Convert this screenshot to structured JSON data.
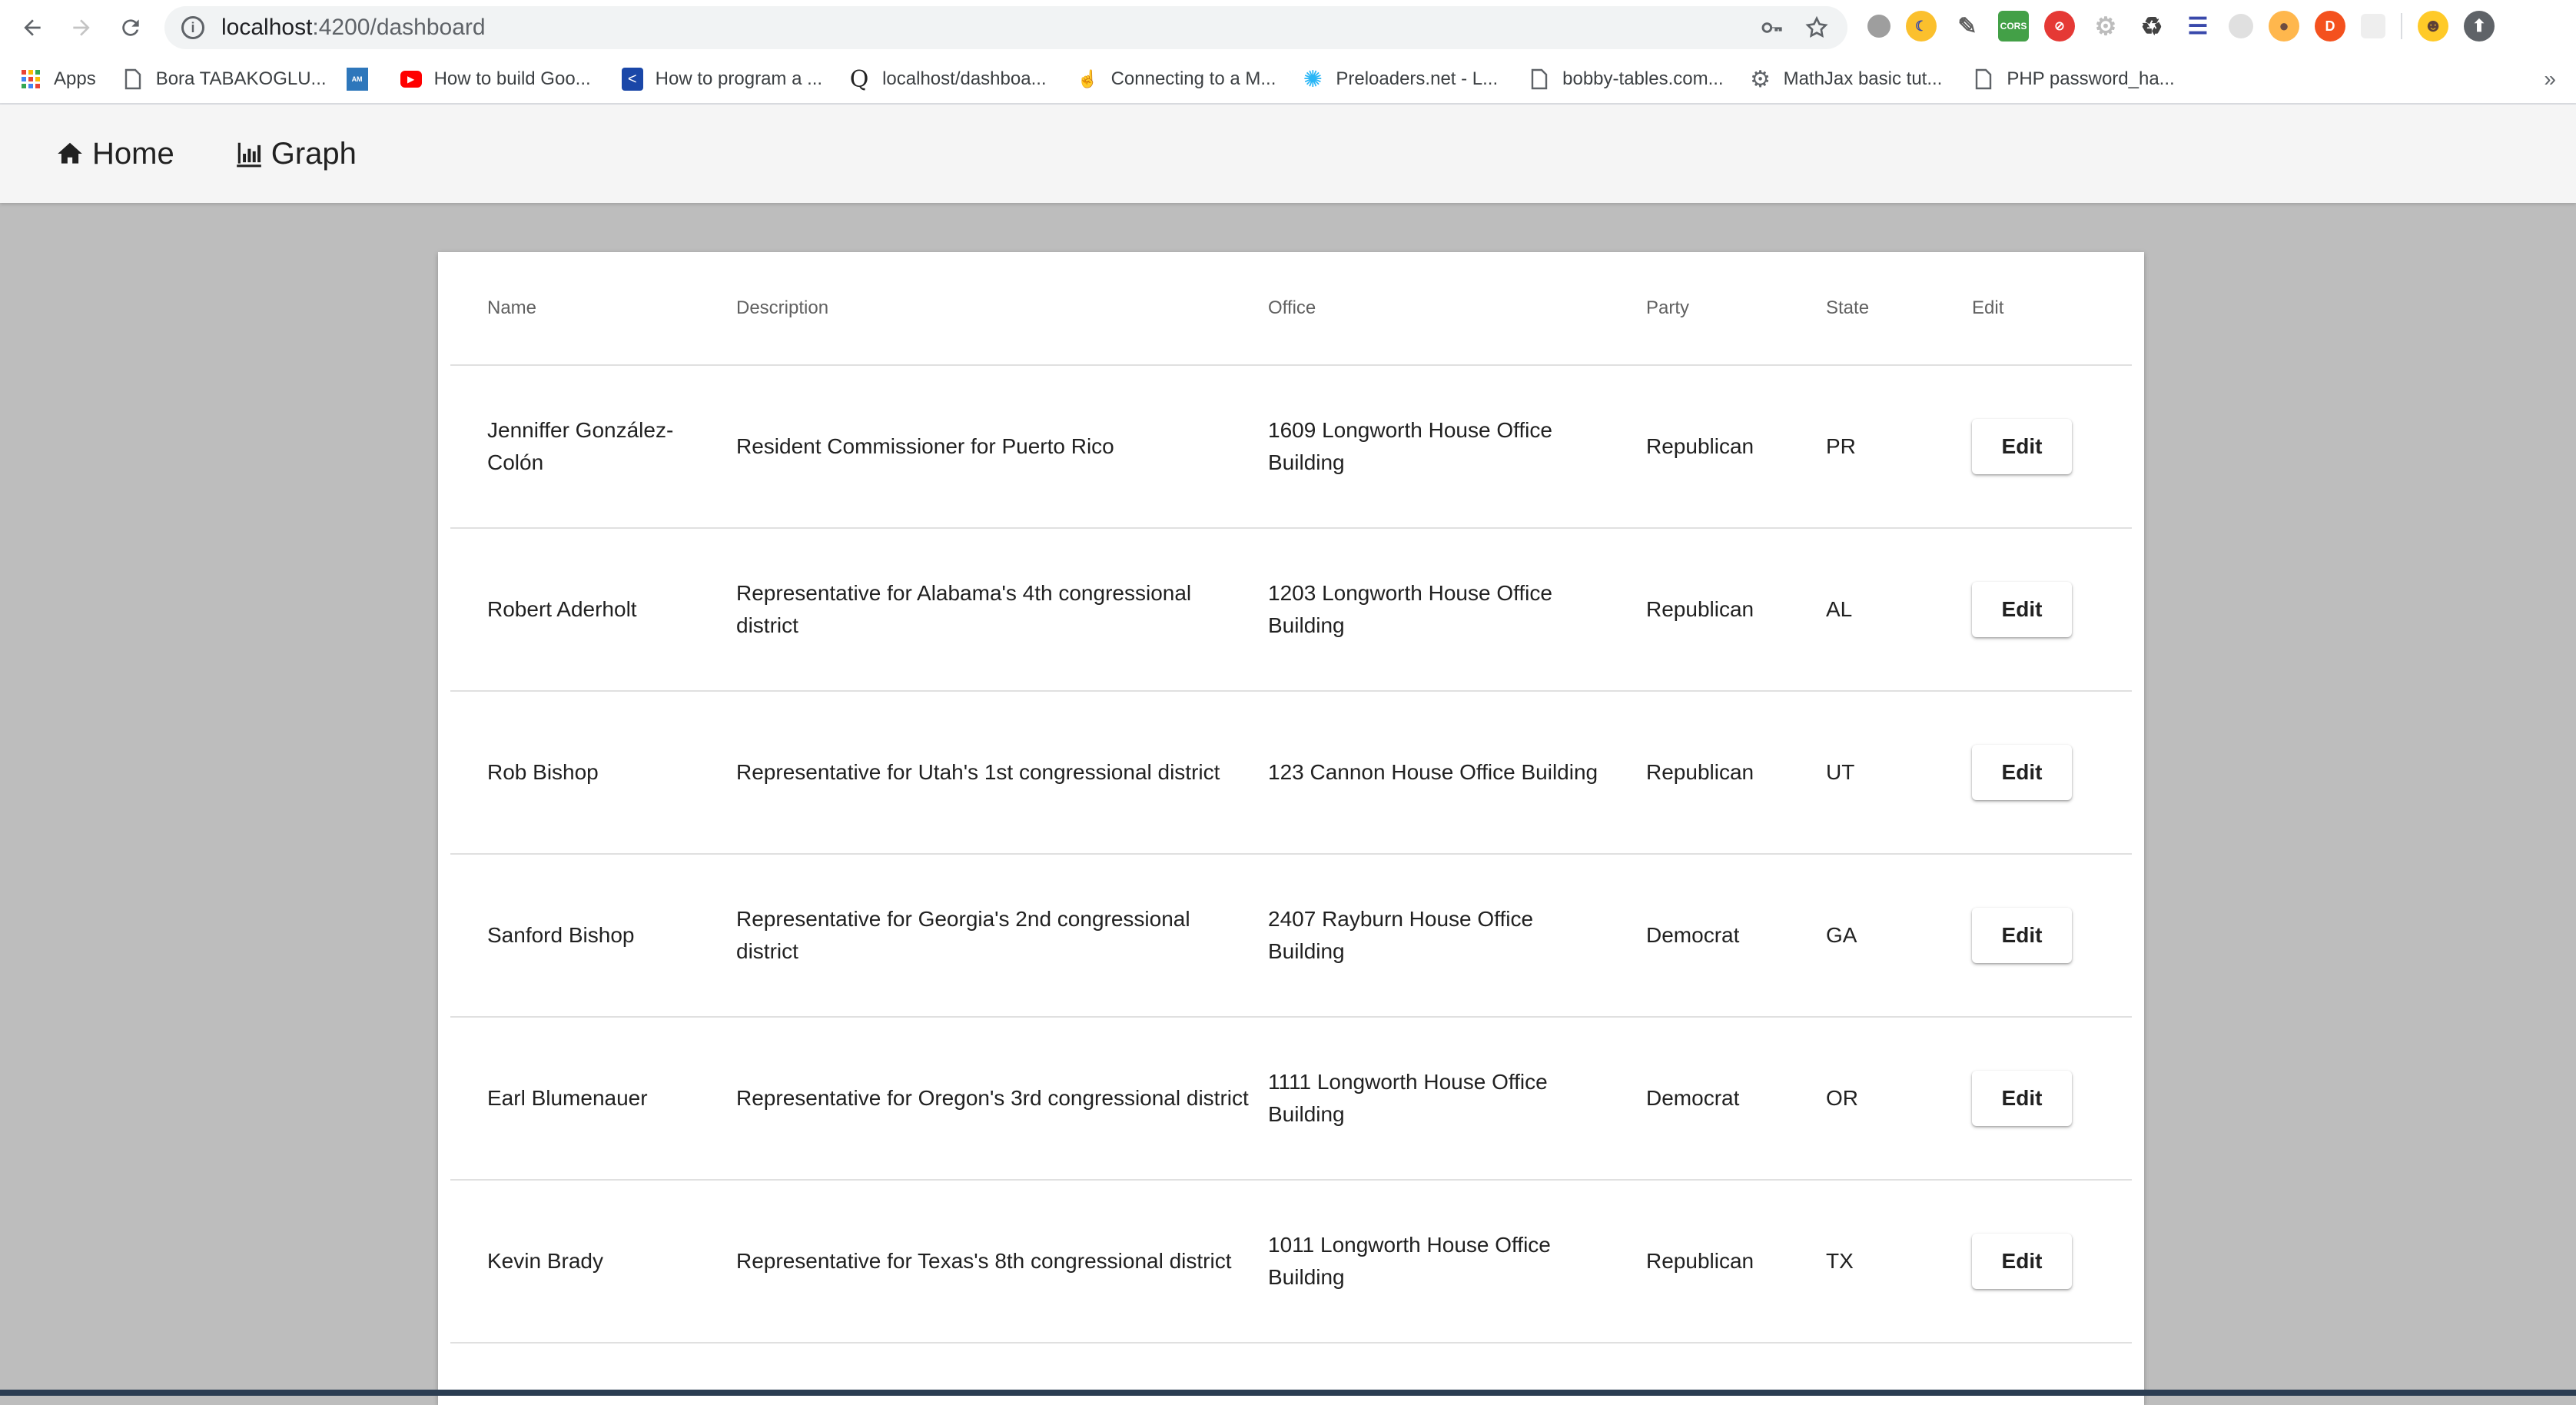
{
  "browser": {
    "url_host": "localhost",
    "url_rest": ":4200/dashboard",
    "bookmarks": [
      {
        "label": "Apps",
        "icon": "apps-grid-icon"
      },
      {
        "label": "Bora TABAKOGLU...",
        "icon": "page-icon"
      },
      {
        "label": "",
        "icon": "amex-icon"
      },
      {
        "label": "How to build Goo...",
        "icon": "youtube-icon"
      },
      {
        "label": "How to program a ...",
        "icon": "arrow-icon"
      },
      {
        "label": "localhost/dashboa...",
        "icon": "quora-icon"
      },
      {
        "label": "Connecting to a M...",
        "icon": "cursor-icon"
      },
      {
        "label": "Preloaders.net - L...",
        "icon": "spinner-icon"
      },
      {
        "label": "bobby-tables.com...",
        "icon": "page-icon"
      },
      {
        "label": "MathJax basic tut...",
        "icon": "gear-icon"
      },
      {
        "label": "PHP password_ha...",
        "icon": "page-icon"
      }
    ],
    "bookmarks_more": "»"
  },
  "app_nav": {
    "home_label": "Home",
    "graph_label": "Graph"
  },
  "table": {
    "headers": {
      "name": "Name",
      "description": "Description",
      "office": "Office",
      "party": "Party",
      "state": "State",
      "edit": "Edit"
    },
    "rows": [
      {
        "name": "Jenniffer González-Colón",
        "description": "Resident Commissioner for Puerto Rico",
        "office": "1609 Longworth House Office Building",
        "party": "Republican",
        "state": "PR",
        "edit_label": "Edit"
      },
      {
        "name": "Robert Aderholt",
        "description": "Representative for Alabama's 4th congressional district",
        "office": "1203 Longworth House Office Building",
        "party": "Republican",
        "state": "AL",
        "edit_label": "Edit"
      },
      {
        "name": "Rob Bishop",
        "description": "Representative for Utah's 1st congressional district",
        "office": "123 Cannon House Office Building",
        "party": "Republican",
        "state": "UT",
        "edit_label": "Edit"
      },
      {
        "name": "Sanford Bishop",
        "description": "Representative for Georgia's 2nd congressional district",
        "office": "2407 Rayburn House Office Building",
        "party": "Democrat",
        "state": "GA",
        "edit_label": "Edit"
      },
      {
        "name": "Earl Blumenauer",
        "description": "Representative for Oregon's 3rd congressional district",
        "office": "1111 Longworth House Office Building",
        "party": "Democrat",
        "state": "OR",
        "edit_label": "Edit"
      },
      {
        "name": "Kevin Brady",
        "description": "Representative for Texas's 8th congressional district",
        "office": "1011 Longworth House Office Building",
        "party": "Republican",
        "state": "TX",
        "edit_label": "Edit"
      }
    ]
  },
  "colors": {
    "page_background": "#bdbdbd",
    "header_background": "#f5f5f5",
    "card_background": "#ffffff"
  }
}
